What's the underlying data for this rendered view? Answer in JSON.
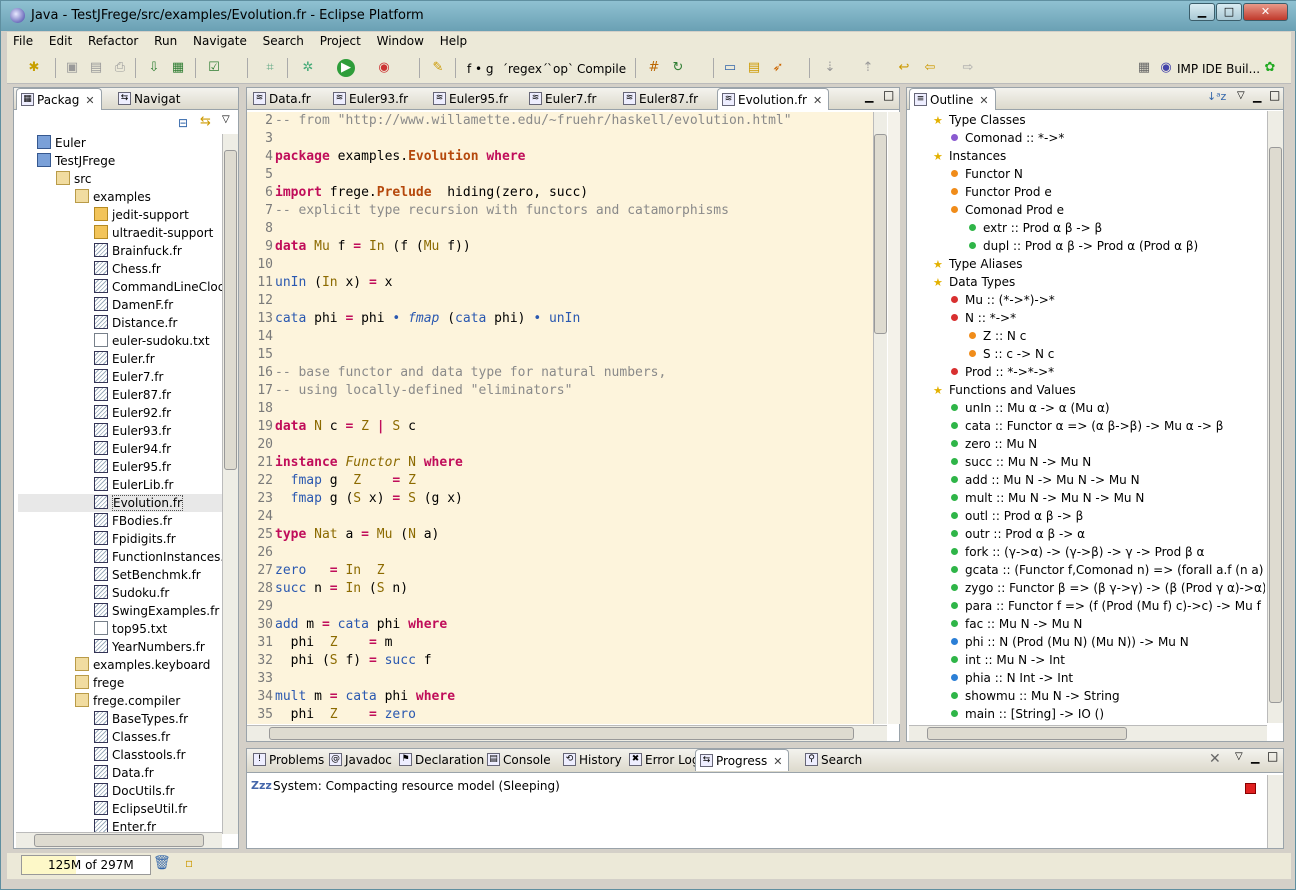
{
  "window": {
    "title": "Java - TestJFrege/src/examples/Evolution.fr - Eclipse Platform",
    "minimize": "▁",
    "maximize": "□",
    "close": "✕"
  },
  "menu": [
    "File",
    "Edit",
    "Refactor",
    "Run",
    "Navigate",
    "Search",
    "Project",
    "Window",
    "Help"
  ],
  "toolbar": {
    "fg_label": "f • g",
    "regex_label": "´regex´",
    "op_label": "`op`",
    "compile_label": "Compile",
    "perspective_label": "IMP IDE Buil..."
  },
  "left_tabs": [
    {
      "label": "Packag",
      "close": "✕"
    },
    {
      "label": "Navigat"
    }
  ],
  "package_tree": [
    {
      "label": "Euler",
      "icon": "project",
      "indent": 1
    },
    {
      "label": "TestJFrege",
      "icon": "project",
      "indent": 1
    },
    {
      "label": "src",
      "icon": "source-folder",
      "indent": 2
    },
    {
      "label": "examples",
      "icon": "package",
      "indent": 3
    },
    {
      "label": "jedit-support",
      "icon": "folder",
      "indent": 4
    },
    {
      "label": "ultraedit-support",
      "icon": "folder",
      "indent": 4
    },
    {
      "label": "Brainfuck.fr",
      "icon": "fr-file",
      "indent": 4
    },
    {
      "label": "Chess.fr",
      "icon": "fr-file",
      "indent": 4
    },
    {
      "label": "CommandLineClocl",
      "icon": "fr-file",
      "indent": 4
    },
    {
      "label": "DamenF.fr",
      "icon": "fr-file",
      "indent": 4
    },
    {
      "label": "Distance.fr",
      "icon": "fr-file",
      "indent": 4
    },
    {
      "label": "euler-sudoku.txt",
      "icon": "text-file",
      "indent": 4
    },
    {
      "label": "Euler.fr",
      "icon": "fr-file",
      "indent": 4
    },
    {
      "label": "Euler7.fr",
      "icon": "fr-file",
      "indent": 4
    },
    {
      "label": "Euler87.fr",
      "icon": "fr-file",
      "indent": 4
    },
    {
      "label": "Euler92.fr",
      "icon": "fr-file",
      "indent": 4
    },
    {
      "label": "Euler93.fr",
      "icon": "fr-file",
      "indent": 4
    },
    {
      "label": "Euler94.fr",
      "icon": "fr-file",
      "indent": 4
    },
    {
      "label": "Euler95.fr",
      "icon": "fr-file",
      "indent": 4
    },
    {
      "label": "EulerLib.fr",
      "icon": "fr-file",
      "indent": 4
    },
    {
      "label": "Evolution.fr",
      "icon": "fr-file",
      "indent": 4,
      "selected": true
    },
    {
      "label": "FBodies.fr",
      "icon": "fr-file",
      "indent": 4
    },
    {
      "label": "Fpidigits.fr",
      "icon": "fr-file",
      "indent": 4
    },
    {
      "label": "FunctionInstances.fr",
      "icon": "fr-file",
      "indent": 4
    },
    {
      "label": "SetBenchmk.fr",
      "icon": "fr-file",
      "indent": 4
    },
    {
      "label": "Sudoku.fr",
      "icon": "fr-file",
      "indent": 4
    },
    {
      "label": "SwingExamples.fr",
      "icon": "fr-file",
      "indent": 4
    },
    {
      "label": "top95.txt",
      "icon": "text-file",
      "indent": 4
    },
    {
      "label": "YearNumbers.fr",
      "icon": "fr-file",
      "indent": 4
    },
    {
      "label": "examples.keyboard",
      "icon": "package",
      "indent": 3
    },
    {
      "label": "frege",
      "icon": "package",
      "indent": 3
    },
    {
      "label": "frege.compiler",
      "icon": "package",
      "indent": 3
    },
    {
      "label": "BaseTypes.fr",
      "icon": "fr-file",
      "indent": 4
    },
    {
      "label": "Classes.fr",
      "icon": "fr-file",
      "indent": 4
    },
    {
      "label": "Classtools.fr",
      "icon": "fr-file",
      "indent": 4
    },
    {
      "label": "Data.fr",
      "icon": "fr-file",
      "indent": 4
    },
    {
      "label": "DocUtils.fr",
      "icon": "fr-file",
      "indent": 4
    },
    {
      "label": "EclipseUtil.fr",
      "icon": "fr-file",
      "indent": 4
    },
    {
      "label": "Enter.fr",
      "icon": "fr-file",
      "indent": 4
    }
  ],
  "editor_tabs": [
    {
      "label": "Data.fr"
    },
    {
      "label": "Euler93.fr"
    },
    {
      "label": "Euler95.fr"
    },
    {
      "label": "Euler7.fr"
    },
    {
      "label": "Euler87.fr"
    },
    {
      "label": "Evolution.fr",
      "active": true
    }
  ],
  "code": [
    {
      "n": "2",
      "parts": [
        {
          "t": "-- from \"http://www.willamette.edu/~fruehr/haskell/evolution.html\"",
          "c": "cm"
        }
      ]
    },
    {
      "n": "3",
      "parts": []
    },
    {
      "n": "4",
      "parts": [
        {
          "t": "package",
          "c": "kw"
        },
        {
          "t": " examples."
        },
        {
          "t": "Evolution",
          "c": "kwb"
        },
        {
          "t": " "
        },
        {
          "t": "where",
          "c": "kw"
        }
      ]
    },
    {
      "n": "5",
      "parts": []
    },
    {
      "n": "6",
      "parts": [
        {
          "t": "import",
          "c": "kw"
        },
        {
          "t": " frege."
        },
        {
          "t": "Prelude",
          "c": "kwb"
        },
        {
          "t": "  hiding(zero, succ)"
        }
      ]
    },
    {
      "n": "7",
      "parts": [
        {
          "t": "-- explicit type recursion with functors and catamorphisms",
          "c": "cm"
        }
      ]
    },
    {
      "n": "8",
      "parts": []
    },
    {
      "n": "9",
      "parts": [
        {
          "t": "data",
          "c": "kw"
        },
        {
          "t": " "
        },
        {
          "t": "Mu",
          "c": "ty"
        },
        {
          "t": " f "
        },
        {
          "t": "=",
          "c": "kw"
        },
        {
          "t": " "
        },
        {
          "t": "In",
          "c": "ty"
        },
        {
          "t": " (f ("
        },
        {
          "t": "Mu",
          "c": "ty"
        },
        {
          "t": " f))"
        }
      ]
    },
    {
      "n": "10",
      "parts": []
    },
    {
      "n": "11",
      "parts": [
        {
          "t": "unIn",
          "c": "fn"
        },
        {
          "t": " ("
        },
        {
          "t": "In",
          "c": "ty"
        },
        {
          "t": " x) "
        },
        {
          "t": "=",
          "c": "kw"
        },
        {
          "t": " x"
        }
      ]
    },
    {
      "n": "12",
      "parts": []
    },
    {
      "n": "13",
      "parts": [
        {
          "t": "cata",
          "c": "fn"
        },
        {
          "t": " phi "
        },
        {
          "t": "=",
          "c": "kw"
        },
        {
          "t": " phi "
        },
        {
          "t": "•",
          "c": "fn"
        },
        {
          "t": " "
        },
        {
          "t": "fmap",
          "c": "it"
        },
        {
          "t": " ("
        },
        {
          "t": "cata",
          "c": "fn"
        },
        {
          "t": " phi) "
        },
        {
          "t": "•",
          "c": "fn"
        },
        {
          "t": " "
        },
        {
          "t": "unIn",
          "c": "fn"
        }
      ]
    },
    {
      "n": "14",
      "parts": []
    },
    {
      "n": "15",
      "parts": []
    },
    {
      "n": "16",
      "parts": [
        {
          "t": "-- base functor and data type for natural numbers,",
          "c": "cm"
        }
      ]
    },
    {
      "n": "17",
      "parts": [
        {
          "t": "-- using locally-defined \"eliminators\"",
          "c": "cm"
        }
      ]
    },
    {
      "n": "18",
      "parts": []
    },
    {
      "n": "19",
      "parts": [
        {
          "t": "data",
          "c": "kw"
        },
        {
          "t": " "
        },
        {
          "t": "N",
          "c": "ty"
        },
        {
          "t": " c "
        },
        {
          "t": "=",
          "c": "kw"
        },
        {
          "t": " "
        },
        {
          "t": "Z",
          "c": "ty"
        },
        {
          "t": " "
        },
        {
          "t": "|",
          "c": "kw"
        },
        {
          "t": " "
        },
        {
          "t": "S",
          "c": "ty"
        },
        {
          "t": " c"
        }
      ]
    },
    {
      "n": "20",
      "parts": []
    },
    {
      "n": "21",
      "parts": [
        {
          "t": "instance",
          "c": "kw"
        },
        {
          "t": " "
        },
        {
          "t": "Functor",
          "c": "ity"
        },
        {
          "t": " "
        },
        {
          "t": "N",
          "c": "ty"
        },
        {
          "t": " "
        },
        {
          "t": "where",
          "c": "kw"
        }
      ]
    },
    {
      "n": "22",
      "parts": [
        {
          "t": "  "
        },
        {
          "t": "fmap",
          "c": "fn"
        },
        {
          "t": " g  "
        },
        {
          "t": "Z",
          "c": "ty"
        },
        {
          "t": "    "
        },
        {
          "t": "=",
          "c": "kw"
        },
        {
          "t": " "
        },
        {
          "t": "Z",
          "c": "ty"
        }
      ]
    },
    {
      "n": "23",
      "parts": [
        {
          "t": "  "
        },
        {
          "t": "fmap",
          "c": "fn"
        },
        {
          "t": " g ("
        },
        {
          "t": "S",
          "c": "ty"
        },
        {
          "t": " x) "
        },
        {
          "t": "=",
          "c": "kw"
        },
        {
          "t": " "
        },
        {
          "t": "S",
          "c": "ty"
        },
        {
          "t": " (g x)"
        }
      ]
    },
    {
      "n": "24",
      "parts": []
    },
    {
      "n": "25",
      "parts": [
        {
          "t": "type",
          "c": "kw"
        },
        {
          "t": " "
        },
        {
          "t": "Nat",
          "c": "ty"
        },
        {
          "t": " a "
        },
        {
          "t": "=",
          "c": "kw"
        },
        {
          "t": " "
        },
        {
          "t": "Mu",
          "c": "ty"
        },
        {
          "t": " ("
        },
        {
          "t": "N",
          "c": "ty"
        },
        {
          "t": " a)"
        }
      ]
    },
    {
      "n": "26",
      "parts": []
    },
    {
      "n": "27",
      "parts": [
        {
          "t": "zero",
          "c": "fn"
        },
        {
          "t": "   "
        },
        {
          "t": "=",
          "c": "kw"
        },
        {
          "t": " "
        },
        {
          "t": "In",
          "c": "ty"
        },
        {
          "t": "  "
        },
        {
          "t": "Z",
          "c": "ty"
        }
      ]
    },
    {
      "n": "28",
      "parts": [
        {
          "t": "succ",
          "c": "fn"
        },
        {
          "t": " n "
        },
        {
          "t": "=",
          "c": "kw"
        },
        {
          "t": " "
        },
        {
          "t": "In",
          "c": "ty"
        },
        {
          "t": " ("
        },
        {
          "t": "S",
          "c": "ty"
        },
        {
          "t": " n)"
        }
      ]
    },
    {
      "n": "29",
      "parts": []
    },
    {
      "n": "30",
      "parts": [
        {
          "t": "add",
          "c": "fn"
        },
        {
          "t": " m "
        },
        {
          "t": "=",
          "c": "kw"
        },
        {
          "t": " "
        },
        {
          "t": "cata",
          "c": "fn"
        },
        {
          "t": " phi "
        },
        {
          "t": "where",
          "c": "kw"
        }
      ]
    },
    {
      "n": "31",
      "parts": [
        {
          "t": "  phi  "
        },
        {
          "t": "Z",
          "c": "ty"
        },
        {
          "t": "    "
        },
        {
          "t": "=",
          "c": "kw"
        },
        {
          "t": " m"
        }
      ]
    },
    {
      "n": "32",
      "parts": [
        {
          "t": "  phi ("
        },
        {
          "t": "S",
          "c": "ty"
        },
        {
          "t": " f) "
        },
        {
          "t": "=",
          "c": "kw"
        },
        {
          "t": " "
        },
        {
          "t": "succ",
          "c": "fn"
        },
        {
          "t": " f"
        }
      ]
    },
    {
      "n": "33",
      "parts": []
    },
    {
      "n": "34",
      "parts": [
        {
          "t": "mult",
          "c": "fn"
        },
        {
          "t": " m "
        },
        {
          "t": "=",
          "c": "kw"
        },
        {
          "t": " "
        },
        {
          "t": "cata",
          "c": "fn"
        },
        {
          "t": " phi "
        },
        {
          "t": "where",
          "c": "kw"
        }
      ]
    },
    {
      "n": "35",
      "parts": [
        {
          "t": "  phi  "
        },
        {
          "t": "Z",
          "c": "ty"
        },
        {
          "t": "    "
        },
        {
          "t": "=",
          "c": "kw"
        },
        {
          "t": " "
        },
        {
          "t": "zero",
          "c": "fn"
        }
      ]
    }
  ],
  "outline_tab": {
    "label": "Outline",
    "close": "✕"
  },
  "outline": [
    {
      "label": "Type Classes",
      "level": 0,
      "bullet": "star"
    },
    {
      "label": "Comonad :: *->*",
      "level": 1,
      "bullet": "purple"
    },
    {
      "label": "Instances",
      "level": 0,
      "bullet": "star"
    },
    {
      "label": "Functor  N",
      "level": 1,
      "bullet": "orange"
    },
    {
      "label": "Functor  Prod e",
      "level": 1,
      "bullet": "orange"
    },
    {
      "label": "Comonad  Prod e",
      "level": 1,
      "bullet": "orange"
    },
    {
      "label": "extr :: Prod α β -> β",
      "level": 2,
      "bullet": "green"
    },
    {
      "label": "dupl :: Prod α β -> Prod α (Prod α β)",
      "level": 2,
      "bullet": "green"
    },
    {
      "label": "Type Aliases",
      "level": 0,
      "bullet": "star"
    },
    {
      "label": "Data Types",
      "level": 0,
      "bullet": "star"
    },
    {
      "label": "Mu :: (*->*)->*",
      "level": 1,
      "bullet": "red"
    },
    {
      "label": "N :: *->*",
      "level": 1,
      "bullet": "red"
    },
    {
      "label": "Z :: N c",
      "level": 2,
      "bullet": "orange"
    },
    {
      "label": "S :: c -> N c",
      "level": 2,
      "bullet": "orange"
    },
    {
      "label": "Prod :: *->*->*",
      "level": 1,
      "bullet": "red"
    },
    {
      "label": "Functions and Values",
      "level": 0,
      "bullet": "star"
    },
    {
      "label": "unIn :: Mu α -> α (Mu α)",
      "level": 1,
      "bullet": "green"
    },
    {
      "label": "cata :: Functor α => (α β->β) -> Mu α -> β",
      "level": 1,
      "bullet": "green"
    },
    {
      "label": "zero :: Mu N",
      "level": 1,
      "bullet": "green"
    },
    {
      "label": "succ :: Mu N -> Mu N",
      "level": 1,
      "bullet": "green"
    },
    {
      "label": "add :: Mu N -> Mu N -> Mu N",
      "level": 1,
      "bullet": "green"
    },
    {
      "label": "mult :: Mu N -> Mu N -> Mu N",
      "level": 1,
      "bullet": "green"
    },
    {
      "label": "outl :: Prod α β -> β",
      "level": 1,
      "bullet": "green"
    },
    {
      "label": "outr :: Prod α β -> α",
      "level": 1,
      "bullet": "green"
    },
    {
      "label": "fork :: (γ->α) -> (γ->β) -> γ -> Prod β α",
      "level": 1,
      "bullet": "green"
    },
    {
      "label": "gcata :: (Functor f,Comonad n) => (forall a.f (n a) -> n (f",
      "level": 1,
      "bullet": "green"
    },
    {
      "label": "zygo :: Functor β => (β γ->γ) -> (β (Prod γ α)->α) -> Mu",
      "level": 1,
      "bullet": "green"
    },
    {
      "label": "para :: Functor f => (f (Prod (Mu f) c)->c) -> Mu f -> c",
      "level": 1,
      "bullet": "green"
    },
    {
      "label": "fac :: Mu N -> Mu N",
      "level": 1,
      "bullet": "green"
    },
    {
      "label": "phi :: N (Prod (Mu N) (Mu N)) -> Mu N",
      "level": 1,
      "bullet": "blue"
    },
    {
      "label": "int :: Mu N -> Int",
      "level": 1,
      "bullet": "green"
    },
    {
      "label": "phia :: N Int -> Int",
      "level": 1,
      "bullet": "blue"
    },
    {
      "label": "showmu :: Mu N -> String",
      "level": 1,
      "bullet": "green"
    },
    {
      "label": "main :: [String] -> IO ()",
      "level": 1,
      "bullet": "green"
    }
  ],
  "bottom_tabs": [
    {
      "label": "Problems"
    },
    {
      "label": "Javadoc"
    },
    {
      "label": "Declaration"
    },
    {
      "label": "Console"
    },
    {
      "label": "History"
    },
    {
      "label": "Error Log"
    },
    {
      "label": "Progress",
      "active": true,
      "close": "✕"
    },
    {
      "label": "Search"
    }
  ],
  "progress": {
    "icon_text": "Zzz",
    "message": "System: Compacting resource model (Sleeping)"
  },
  "status": {
    "heap": "125M of 297M",
    "heap_used_fraction": 0.42
  }
}
